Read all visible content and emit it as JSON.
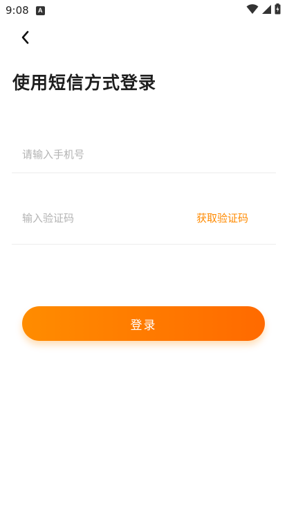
{
  "status_bar": {
    "time": "9:08",
    "notification_badge": "A",
    "icons": [
      "wifi-icon",
      "signal-icon",
      "battery-icon"
    ]
  },
  "header": {
    "back_icon": "chevron-left-icon"
  },
  "title": "使用短信方式登录",
  "phone_field": {
    "placeholder": "请输入手机号",
    "value": ""
  },
  "code_field": {
    "placeholder": "输入验证码",
    "value": "",
    "get_code_label": "获取验证码"
  },
  "login_button": {
    "label": "登录"
  },
  "colors": {
    "accent": "#ff8a00",
    "gradient_start": "#ff8c00",
    "gradient_end": "#ff6a00",
    "title_text": "#1e1e1e",
    "placeholder_text": "#b3b3b3"
  }
}
